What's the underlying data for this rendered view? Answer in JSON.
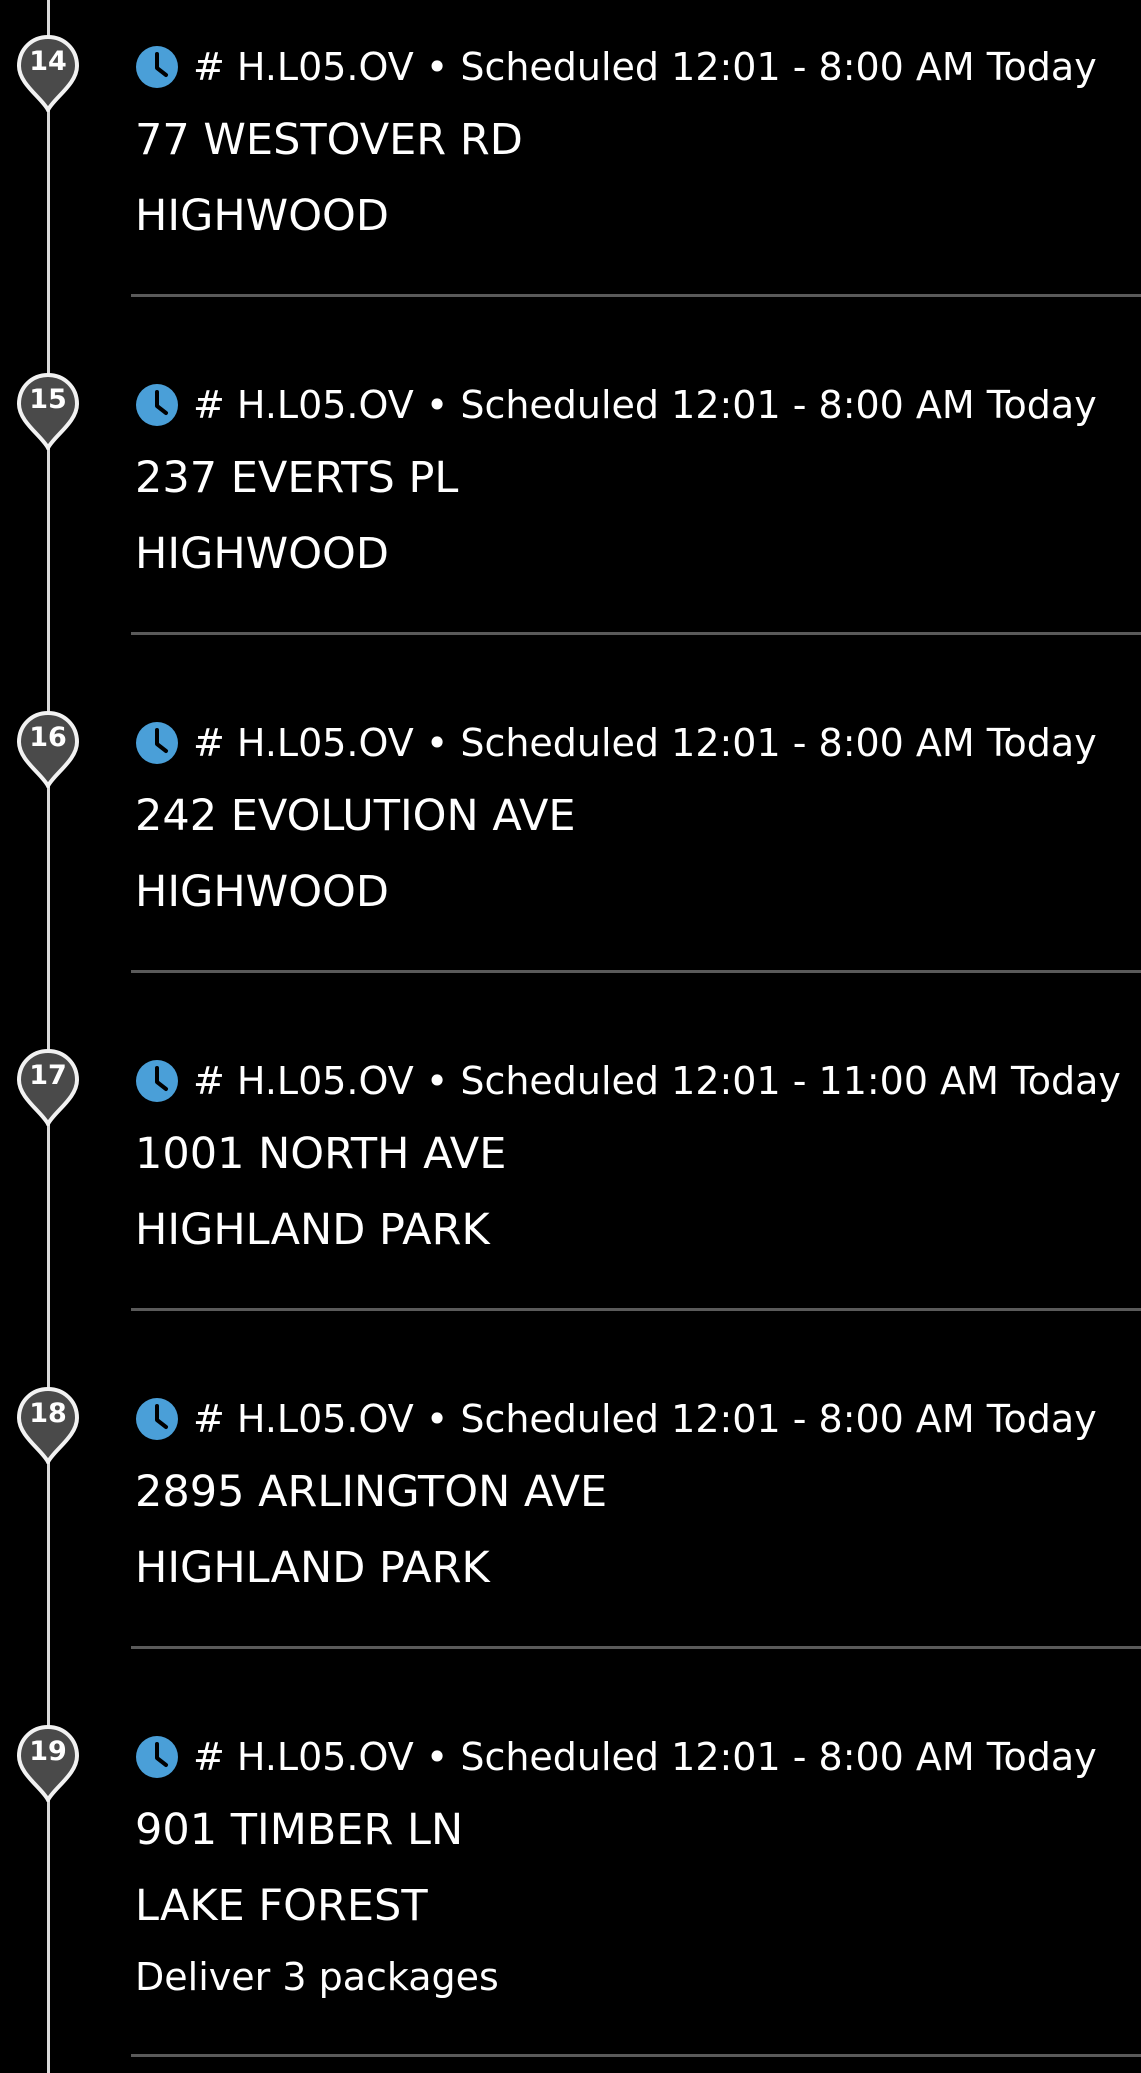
{
  "stops": [
    {
      "number": "14",
      "meta": "# H.L05.OV • Scheduled 12:01 - 8:00 AM Today",
      "address": "77 WESTOVER RD",
      "city": "HIGHWOOD"
    },
    {
      "number": "15",
      "meta": "# H.L05.OV • Scheduled 12:01 - 8:00 AM Today",
      "address": "237 EVERTS PL",
      "city": "HIGHWOOD"
    },
    {
      "number": "16",
      "meta": "# H.L05.OV • Scheduled 12:01 - 8:00 AM Today",
      "address": "242 EVOLUTION AVE",
      "city": "HIGHWOOD"
    },
    {
      "number": "17",
      "meta": "# H.L05.OV • Scheduled 12:01 - 11:00 AM Today",
      "address": "1001 NORTH AVE",
      "city": "HIGHLAND PARK"
    },
    {
      "number": "18",
      "meta": "# H.L05.OV • Scheduled 12:01 - 8:00 AM Today",
      "address": "2895 ARLINGTON AVE",
      "city": "HIGHLAND PARK"
    },
    {
      "number": "19",
      "meta": "# H.L05.OV • Scheduled 12:01 - 8:00 AM Today",
      "address": "901 TIMBER LN",
      "city": "LAKE FOREST",
      "note": "Deliver 3 packages"
    }
  ],
  "icons": {
    "pin": "map-pin-icon",
    "clock": "clock-icon"
  },
  "colors": {
    "background": "#000000",
    "text": "#ffffff",
    "clock": "#4a9fd8",
    "pin": "#4a4a4a",
    "pin_outline": "#f2f2f2",
    "timeline": "#d9d9d9",
    "divider": "#5a5a5a"
  }
}
